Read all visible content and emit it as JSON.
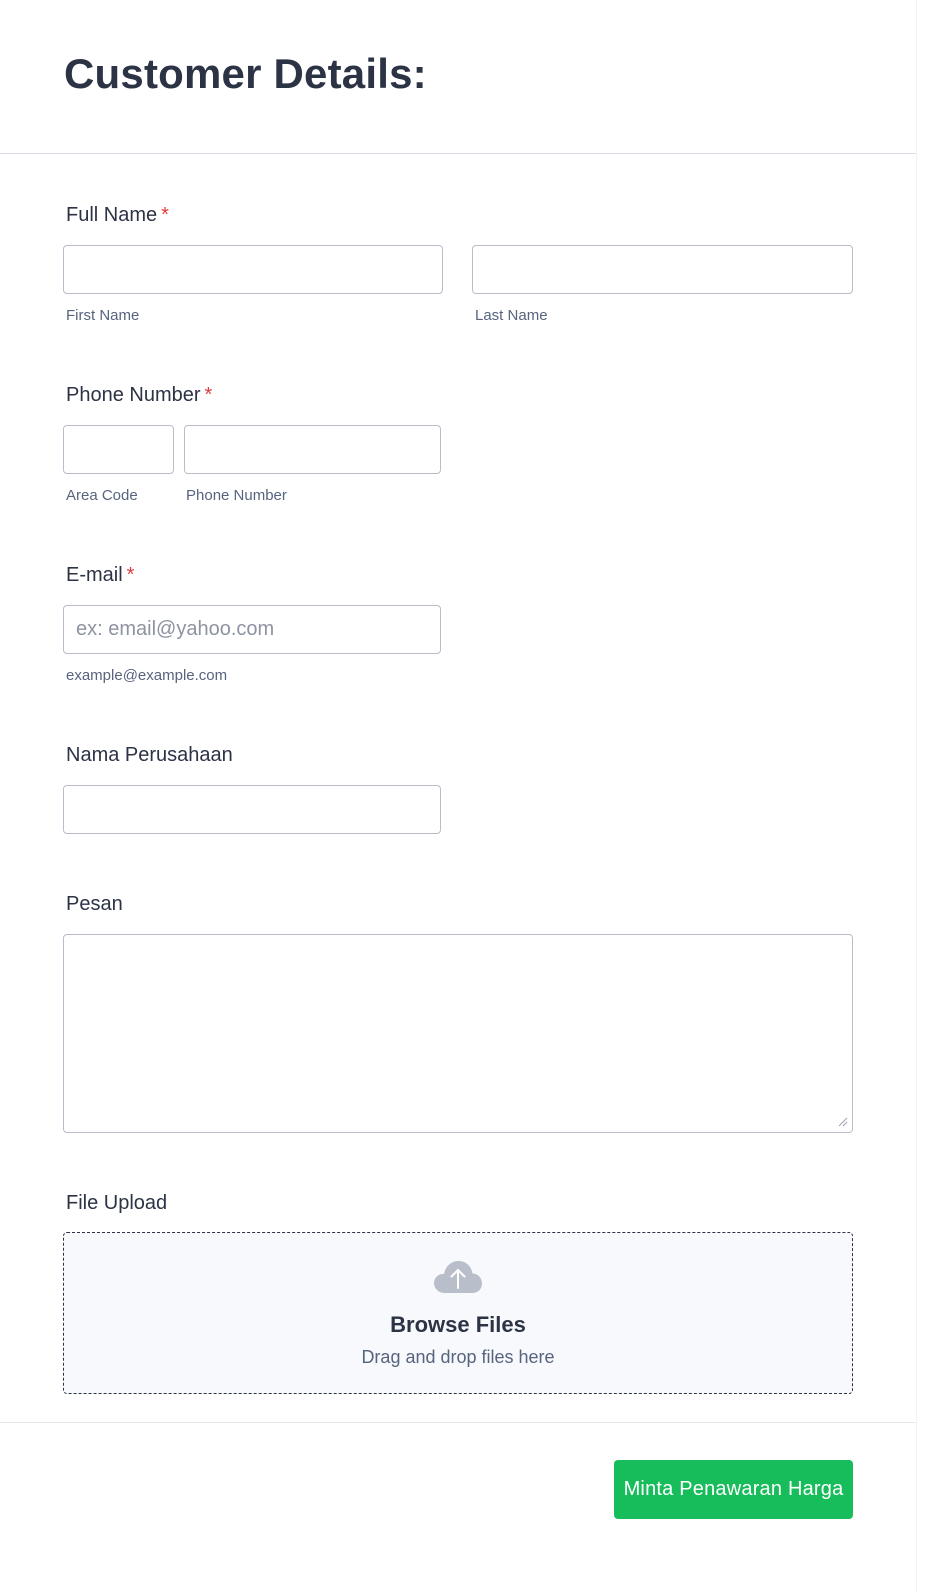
{
  "form": {
    "title": "Customer Details:"
  },
  "full_name": {
    "label": "Full Name",
    "required_mark": "*",
    "first": {
      "value": "",
      "sublabel": "First Name"
    },
    "last": {
      "value": "",
      "sublabel": "Last Name"
    }
  },
  "phone": {
    "label": "Phone Number",
    "required_mark": "*",
    "area": {
      "value": "",
      "sublabel": "Area Code"
    },
    "number": {
      "value": "",
      "sublabel": "Phone Number"
    }
  },
  "email": {
    "label": "E-mail",
    "required_mark": "*",
    "value": "",
    "placeholder": "ex: email@yahoo.com",
    "sublabel": "example@example.com"
  },
  "company": {
    "label": "Nama Perusahaan",
    "value": ""
  },
  "message": {
    "label": "Pesan",
    "value": ""
  },
  "upload": {
    "label": "File Upload",
    "icon": "cloud-upload-icon",
    "title": "Browse Files",
    "subtitle": "Drag and drop files here"
  },
  "submit": {
    "label": "Minta Penawaran Harga",
    "color": "#18bd5b"
  },
  "colors": {
    "text": "#2c3345",
    "required": "#e03b3b",
    "sublabel": "#57647e",
    "border": "#b8bdc9"
  }
}
